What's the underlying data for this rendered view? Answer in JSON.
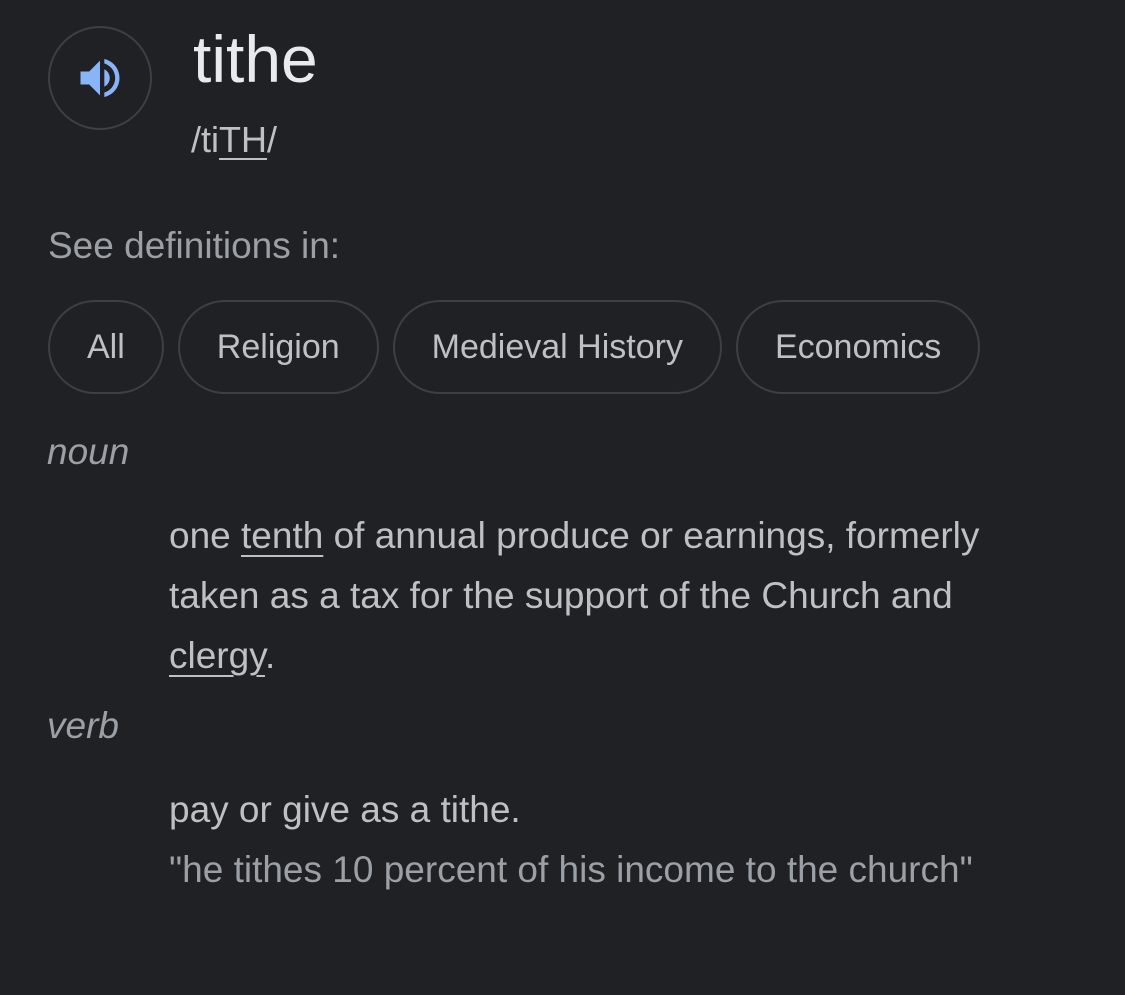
{
  "headword": {
    "word": "tithe",
    "phonetic_before": "/ti",
    "phonetic_underlined": "TH",
    "phonetic_after": "/"
  },
  "icons": {
    "speaker": "speaker-icon",
    "accent_color": "#8ab4f8"
  },
  "see_definitions": {
    "label": "See definitions in:",
    "chips": [
      "All",
      "Religion",
      "Medieval History",
      "Economics"
    ]
  },
  "noun": {
    "label": "noun",
    "def_part1": "one ",
    "link1": "tenth",
    "def_part2": " of annual produce or earnings, formerly taken as a tax for the support of the Church and ",
    "link2": "clergy",
    "def_part3": "."
  },
  "verb": {
    "label": "verb",
    "definition": "pay or give as a tithe.",
    "example": "\"he tithes 10 percent of his income to the church\""
  }
}
